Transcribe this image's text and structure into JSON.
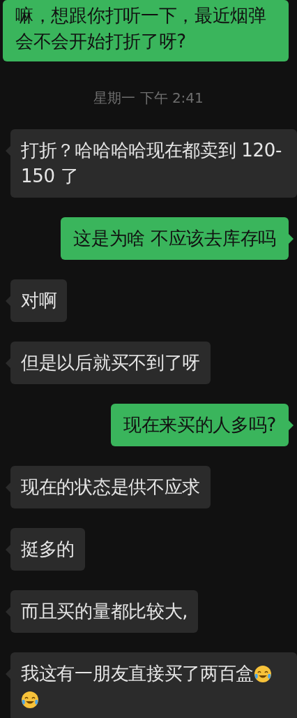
{
  "messages": [
    {
      "kind": "message",
      "outgoing": true,
      "parts": [
        {
          "kind": "text",
          "text": "嘛，想跟你打听一下，最近烟弹会不会开始打折了呀?"
        }
      ]
    },
    {
      "kind": "time",
      "text": "星期一 下午 2:41"
    },
    {
      "kind": "message",
      "outgoing": false,
      "parts": [
        {
          "kind": "text",
          "text": "打折？哈哈哈哈现在都卖到 120-150 了"
        }
      ]
    },
    {
      "kind": "message",
      "outgoing": true,
      "parts": [
        {
          "kind": "text",
          "text": "这是为啥 不应该去库存吗"
        }
      ]
    },
    {
      "kind": "message",
      "outgoing": false,
      "parts": [
        {
          "kind": "text",
          "text": "对啊"
        }
      ]
    },
    {
      "kind": "message",
      "outgoing": false,
      "parts": [
        {
          "kind": "text",
          "text": "但是以后就买不到了呀"
        }
      ]
    },
    {
      "kind": "message",
      "outgoing": true,
      "parts": [
        {
          "kind": "text",
          "text": "现在来买的人多吗?"
        }
      ]
    },
    {
      "kind": "message",
      "outgoing": false,
      "parts": [
        {
          "kind": "text",
          "text": "现在的状态是供不应求"
        }
      ]
    },
    {
      "kind": "message",
      "outgoing": false,
      "parts": [
        {
          "kind": "text",
          "text": "挺多的"
        }
      ]
    },
    {
      "kind": "message",
      "outgoing": false,
      "parts": [
        {
          "kind": "text",
          "text": "而且买的量都比较大,"
        }
      ]
    },
    {
      "kind": "message",
      "outgoing": false,
      "parts": [
        {
          "kind": "text",
          "text": "我这有一朋友直接买了两百盒"
        },
        {
          "kind": "emoji"
        },
        {
          "kind": "emoji"
        }
      ]
    }
  ]
}
